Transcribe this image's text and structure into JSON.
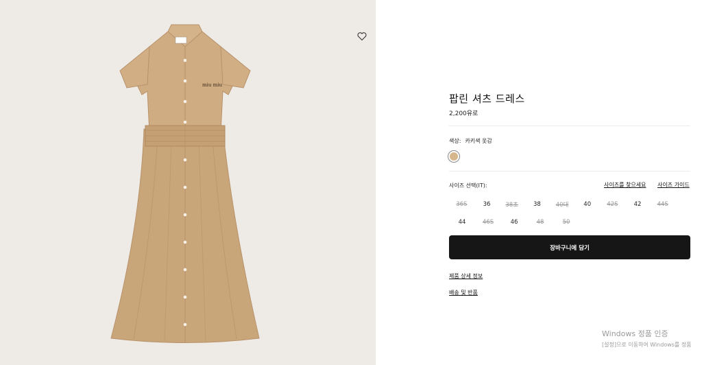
{
  "product": {
    "name": "팝린 셔츠 드레스",
    "price": "2,200유로",
    "image_alt": "Khaki poplin shirt dress",
    "logo_text": "miu miu"
  },
  "color": {
    "label": "색상:",
    "value": "카키색 옷감",
    "swatch_hex": "#d6b68b"
  },
  "size": {
    "label": "사이즈 선택(IT):",
    "find_size_link": "사이즈를 찾으세요",
    "guide_link": "사이즈 가이드",
    "rows": [
      [
        {
          "label": "36S",
          "available": false
        },
        {
          "label": "36",
          "available": true
        },
        {
          "label": "38초",
          "available": false
        },
        {
          "label": "38",
          "available": true
        },
        {
          "label": "40대",
          "available": false
        },
        {
          "label": "40",
          "available": true
        },
        {
          "label": "42S",
          "available": false
        },
        {
          "label": "42",
          "available": true
        },
        {
          "label": "44S",
          "available": false
        }
      ],
      [
        {
          "label": "44",
          "available": true
        },
        {
          "label": "46S",
          "available": false
        },
        {
          "label": "46",
          "available": true
        },
        {
          "label": "48",
          "available": false
        },
        {
          "label": "50",
          "available": false
        }
      ]
    ]
  },
  "cart_button": "장바구니에 담기",
  "links": {
    "details": "제품 상세 정보",
    "shipping": "배송 및 반품"
  },
  "icons": {
    "wishlist": "heart-icon"
  },
  "watermark": {
    "line1": "Windows 정품 인증",
    "line2": "[설정]으로 이동하여 Windows를 정품"
  }
}
